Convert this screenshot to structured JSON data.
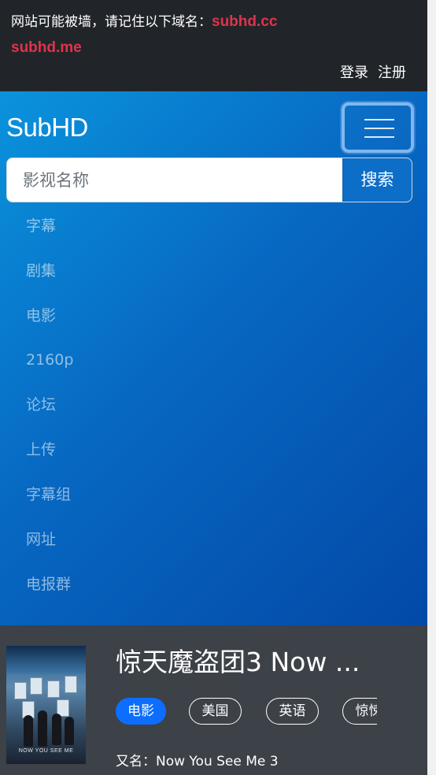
{
  "notice": {
    "message": "网站可能被墙，请记住以下域名：",
    "domain_primary": "subhd.cc",
    "domain_secondary": "subhd.me"
  },
  "auth": {
    "login": "登录",
    "register": "注册"
  },
  "navbar": {
    "brand": "SubHD",
    "toggler_icon": "hamburger-menu-icon",
    "search": {
      "placeholder": "影视名称",
      "button": "搜索"
    },
    "items": [
      {
        "label": "字幕"
      },
      {
        "label": "剧集"
      },
      {
        "label": "电影"
      },
      {
        "label": "2160p"
      },
      {
        "label": "论坛"
      },
      {
        "label": "上传"
      },
      {
        "label": "字幕组"
      },
      {
        "label": "网址"
      },
      {
        "label": "电报群"
      }
    ]
  },
  "movie": {
    "title": "惊天魔盗团3 Now ...",
    "poster_text": "NOW YOU SEE ME",
    "tags": [
      "电影",
      "美国",
      "英语",
      "惊悚"
    ],
    "aka": "又名：Now You See Me 3"
  },
  "colors": {
    "notice_bg": "#212529",
    "domain_red": "#e0334d",
    "nav_gradient_start": "#0a93dc",
    "nav_gradient_end": "#0349a6",
    "search_button": "#0d6ec7",
    "content_bg": "#3d4148",
    "tag_primary": "#0d6efd"
  }
}
